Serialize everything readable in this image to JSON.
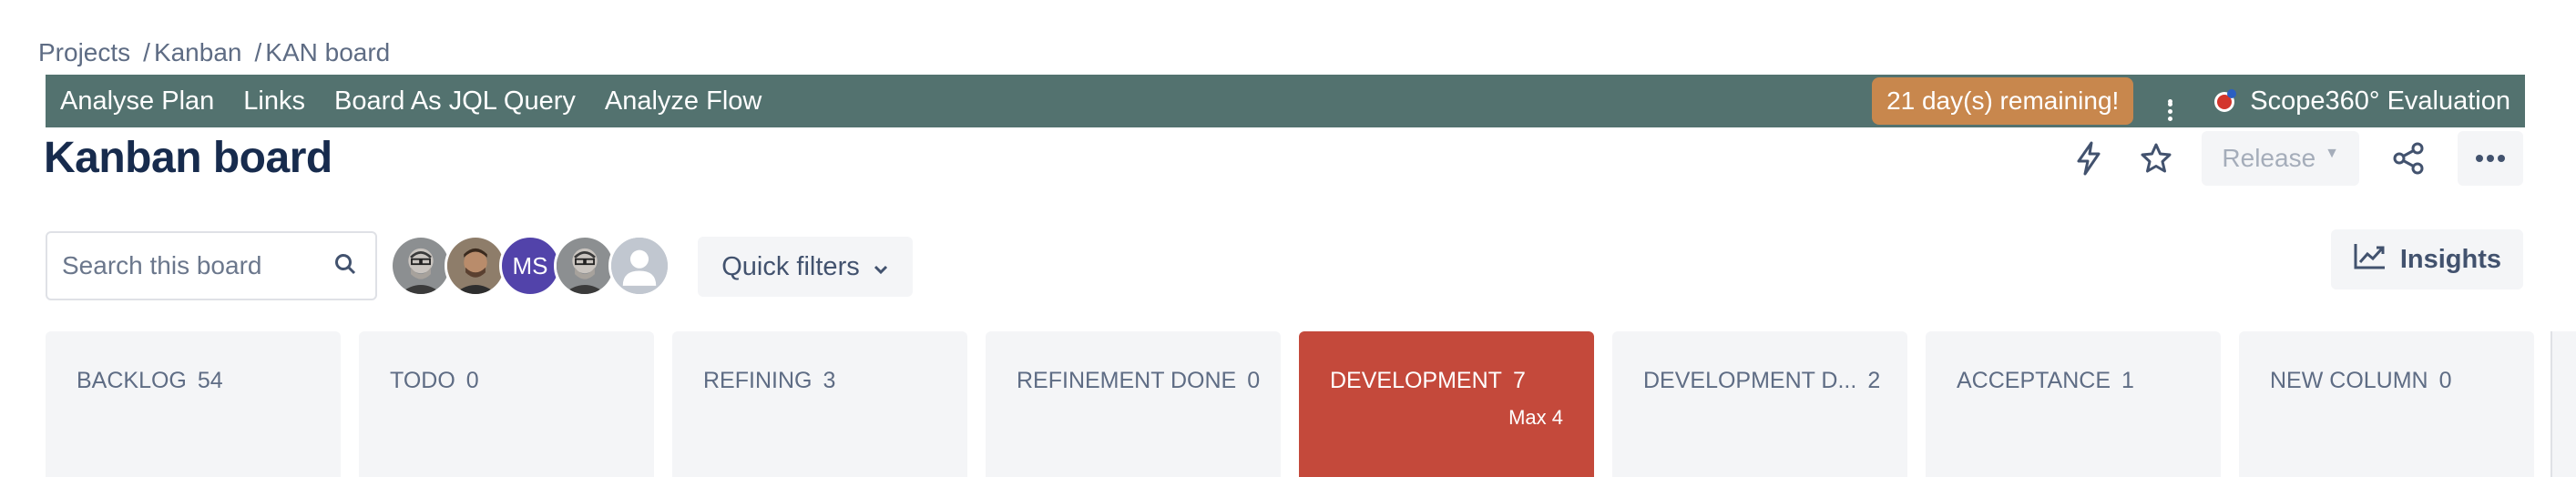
{
  "breadcrumb": [
    {
      "label": "Projects"
    },
    {
      "label": "Kanban"
    },
    {
      "label": "KAN board"
    }
  ],
  "plugin_bar": {
    "links": [
      "Analyse Plan",
      "Links",
      "Board As JQL Query",
      "Analyze Flow"
    ],
    "trial_badge": "21 day(s) remaining!",
    "app_title": "Scope360° Evaluation",
    "background_color": "#53726f",
    "badge_color": "#c8874d"
  },
  "page": {
    "title": "Kanban board"
  },
  "actions": {
    "release_label": "Release",
    "icons": [
      "automation-icon",
      "star-icon",
      "share-icon",
      "more-icon"
    ]
  },
  "toolbar": {
    "search_placeholder": "Search this board",
    "avatars": [
      {
        "type": "photo"
      },
      {
        "type": "photo"
      },
      {
        "type": "initials",
        "initials": "MS"
      },
      {
        "type": "photo"
      },
      {
        "type": "default"
      }
    ],
    "quick_filters_label": "Quick filters",
    "insights_label": "Insights"
  },
  "columns": [
    {
      "name": "BACKLOG",
      "count": "54"
    },
    {
      "name": "TODO",
      "count": "0"
    },
    {
      "name": "REFINING",
      "count": "3"
    },
    {
      "name": "REFINEMENT DONE",
      "count": "0"
    },
    {
      "name": "DEVELOPMENT",
      "count": "7",
      "max": "Max 4",
      "over_limit": true
    },
    {
      "name": "DEVELOPMENT D...",
      "count": "2"
    },
    {
      "name": "ACCEPTANCE",
      "count": "1"
    },
    {
      "name": "NEW COLUMN",
      "count": "0"
    }
  ],
  "colors": {
    "over_limit": "#c4493b",
    "column_bg": "#f4f5f7",
    "text_primary": "#172b4d"
  }
}
